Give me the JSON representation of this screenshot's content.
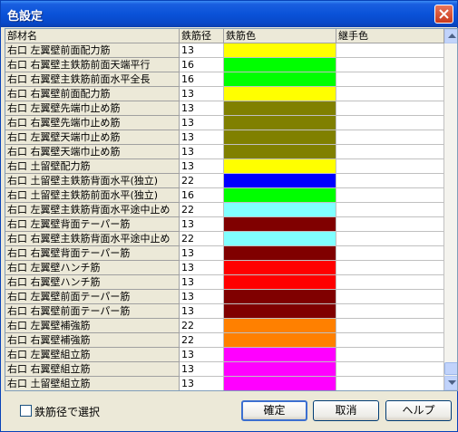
{
  "window": {
    "title": "色設定"
  },
  "grid": {
    "headers": [
      "部材名",
      "鉄筋径",
      "鉄筋色",
      "継手色"
    ],
    "rows": [
      {
        "name": "右口 左翼壁前面配力筋",
        "diameter": "13",
        "color": "#ffff00"
      },
      {
        "name": "右口 右翼壁主鉄筋前面天端平行",
        "diameter": "16",
        "color": "#00ff00"
      },
      {
        "name": "右口 右翼壁主鉄筋前面水平全長",
        "diameter": "16",
        "color": "#00ff00"
      },
      {
        "name": "右口 右翼壁前面配力筋",
        "diameter": "13",
        "color": "#ffff00"
      },
      {
        "name": "右口 左翼壁先端巾止め筋",
        "diameter": "13",
        "color": "#808000"
      },
      {
        "name": "右口 右翼壁先端巾止め筋",
        "diameter": "13",
        "color": "#808000"
      },
      {
        "name": "右口 左翼壁天端巾止め筋",
        "diameter": "13",
        "color": "#808000"
      },
      {
        "name": "右口 右翼壁天端巾止め筋",
        "diameter": "13",
        "color": "#808000"
      },
      {
        "name": "右口 土留壁配力筋",
        "diameter": "13",
        "color": "#ffff00"
      },
      {
        "name": "右口 土留壁主鉄筋背面水平(独立)",
        "diameter": "22",
        "color": "#0000ff"
      },
      {
        "name": "右口 土留壁主鉄筋前面水平(独立)",
        "diameter": "16",
        "color": "#00ff00"
      },
      {
        "name": "右口 左翼壁主鉄筋背面水平途中止め",
        "diameter": "22",
        "color": "#80ffff"
      },
      {
        "name": "右口 左翼壁背面テーパー筋",
        "diameter": "13",
        "color": "#800000"
      },
      {
        "name": "右口 右翼壁主鉄筋背面水平途中止め",
        "diameter": "22",
        "color": "#80ffff"
      },
      {
        "name": "右口 右翼壁背面テーパー筋",
        "diameter": "13",
        "color": "#800000"
      },
      {
        "name": "右口 左翼壁ハンチ筋",
        "diameter": "13",
        "color": "#ff0000"
      },
      {
        "name": "右口 右翼壁ハンチ筋",
        "diameter": "13",
        "color": "#ff0000"
      },
      {
        "name": "右口 左翼壁前面テーパー筋",
        "diameter": "13",
        "color": "#800000"
      },
      {
        "name": "右口 右翼壁前面テーパー筋",
        "diameter": "13",
        "color": "#800000"
      },
      {
        "name": "右口 左翼壁補強筋",
        "diameter": "22",
        "color": "#ff8000"
      },
      {
        "name": "右口 右翼壁補強筋",
        "diameter": "22",
        "color": "#ff8000"
      },
      {
        "name": "右口 左翼壁組立筋",
        "diameter": "13",
        "color": "#ff00ff"
      },
      {
        "name": "右口 右翼壁組立筋",
        "diameter": "13",
        "color": "#ff00ff"
      },
      {
        "name": "右口 土留壁組立筋",
        "diameter": "13",
        "color": "#ff00ff"
      }
    ]
  },
  "checkbox": {
    "label": "鉄筋径で選択",
    "checked": false
  },
  "buttons": {
    "ok": "確定",
    "cancel": "取消",
    "help": "ヘルプ"
  }
}
